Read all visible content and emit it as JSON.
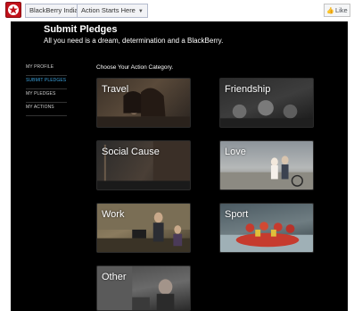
{
  "topbar": {
    "page_name": "BlackBerry India",
    "tab_label": "Action Starts Here",
    "like_label": "Like",
    "logo_icon": "blackberry-star-logo-icon",
    "brand_color": "#c1111a"
  },
  "app": {
    "title": "Submit Pledges",
    "subtitle": "All you need is a dream, determination and a BlackBerry.",
    "background": "#000000"
  },
  "leftnav": {
    "items": [
      {
        "label": "MY PROFILE"
      },
      {
        "label": "SUBMIT PLEDGES"
      },
      {
        "label": "MY PLEDGES"
      },
      {
        "label": "MY ACTIONS"
      }
    ],
    "active_color": "#3ba3de"
  },
  "categories": {
    "heading": "Choose Your Action Category.",
    "items": [
      {
        "label": "Travel"
      },
      {
        "label": "Friendship"
      },
      {
        "label": "Social Cause"
      },
      {
        "label": "Love"
      },
      {
        "label": "Work"
      },
      {
        "label": "Sport"
      },
      {
        "label": "Other"
      }
    ]
  }
}
